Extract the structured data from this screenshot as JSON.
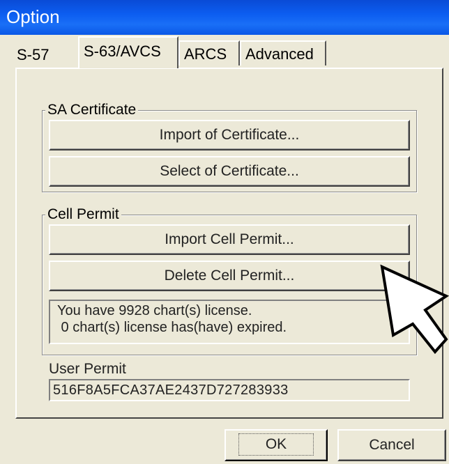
{
  "window": {
    "title": "Option"
  },
  "tabs": [
    {
      "label": "S-57"
    },
    {
      "label": "S-63/AVCS"
    },
    {
      "label": "ARCS"
    },
    {
      "label": "Advanced"
    }
  ],
  "sa_certificate": {
    "legend": "SA Certificate",
    "import_label": "Import of Certificate...",
    "select_label": "Select of Certificate..."
  },
  "cell_permit": {
    "legend": "Cell Permit",
    "import_label": "Import Cell Permit...",
    "delete_label": "Delete Cell Permit...",
    "info_line1": "You have 9928 chart(s) license.",
    "info_line2": " 0 chart(s) license has(have) expired."
  },
  "user_permit": {
    "label": "User Permit",
    "value": "516F8A5FCA37AE2437D727283933"
  },
  "footer": {
    "ok_label": "OK",
    "cancel_label": "Cancel"
  },
  "icons": {
    "cursor": "arrow-cursor-icon"
  }
}
